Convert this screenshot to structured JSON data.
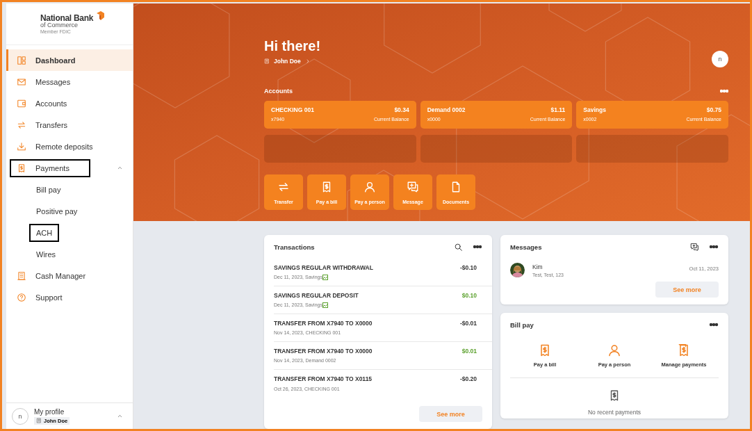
{
  "logo": {
    "name": "National Bank",
    "sub": "of Commerce",
    "tagline": "Member FDIC"
  },
  "sidebar": {
    "items": [
      {
        "label": "Dashboard",
        "selected": true,
        "highlighted": false
      },
      {
        "label": "Messages",
        "selected": false,
        "highlighted": false
      },
      {
        "label": "Accounts",
        "selected": false,
        "highlighted": false
      },
      {
        "label": "Transfers",
        "selected": false,
        "highlighted": false
      },
      {
        "label": "Remote deposits",
        "selected": false,
        "highlighted": false
      },
      {
        "label": "Payments",
        "selected": false,
        "highlighted": true,
        "expanded": true,
        "children": [
          {
            "label": "Bill pay",
            "selected": false,
            "highlighted": false
          },
          {
            "label": "Positive pay",
            "selected": false,
            "highlighted": false
          },
          {
            "label": "ACH",
            "selected": false,
            "highlighted": true
          },
          {
            "label": "Wires",
            "selected": false,
            "highlighted": false
          }
        ]
      },
      {
        "label": "Cash Manager",
        "selected": false,
        "highlighted": false
      },
      {
        "label": "Support",
        "selected": false,
        "highlighted": false
      }
    ],
    "profile": {
      "avatar": "n",
      "label": "My profile",
      "name": "John Doe"
    }
  },
  "hero": {
    "greeting": "Hi there!",
    "user": "John Doe",
    "avatar": "n",
    "accounts_title": "Accounts",
    "accounts": [
      {
        "name": "CHECKING 001",
        "number": "x7940",
        "balance": "$0.34",
        "balance_label": "Current Balance"
      },
      {
        "name": "Demand 0002",
        "number": "x0000",
        "balance": "$1.11",
        "balance_label": "Current Balance"
      },
      {
        "name": "Savings",
        "number": "x0002",
        "balance": "$0.75",
        "balance_label": "Current Balance"
      }
    ],
    "quick_actions": [
      "Transfer",
      "Pay a bill",
      "Pay a person",
      "Message",
      "Documents"
    ]
  },
  "transactions": {
    "title": "Transactions",
    "rows": [
      {
        "title": "SAVINGS REGULAR WITHDRAWAL",
        "detail": "Dec 11, 2023, Savings",
        "amount": "-$0.10",
        "kind": "debit",
        "flagged": true
      },
      {
        "title": "SAVINGS REGULAR DEPOSIT",
        "detail": "Dec 11, 2023, Savings",
        "amount": "$0.10",
        "kind": "credit",
        "flagged": true
      },
      {
        "title": "TRANSFER FROM X7940 TO X0000",
        "detail": "Nov 14, 2023, CHECKING 001",
        "amount": "-$0.01",
        "kind": "debit",
        "flagged": false
      },
      {
        "title": "TRANSFER FROM X7940 TO X0000",
        "detail": "Nov 14, 2023, Demand 0002",
        "amount": "$0.01",
        "kind": "credit",
        "flagged": false
      },
      {
        "title": "TRANSFER FROM X7940 TO X0115",
        "detail": "Oct 26, 2023, CHECKING 001",
        "amount": "-$0.20",
        "kind": "debit",
        "flagged": false
      }
    ],
    "see_more": "See more"
  },
  "messages": {
    "title": "Messages",
    "items": [
      {
        "sender": "Kim",
        "preview": "Test, Test, 123",
        "date": "Oct 11, 2023"
      }
    ],
    "see_more": "See more"
  },
  "bill_pay": {
    "title": "Bill pay",
    "actions": [
      "Pay a bill",
      "Pay a person",
      "Manage payments"
    ],
    "empty": "No recent payments"
  }
}
